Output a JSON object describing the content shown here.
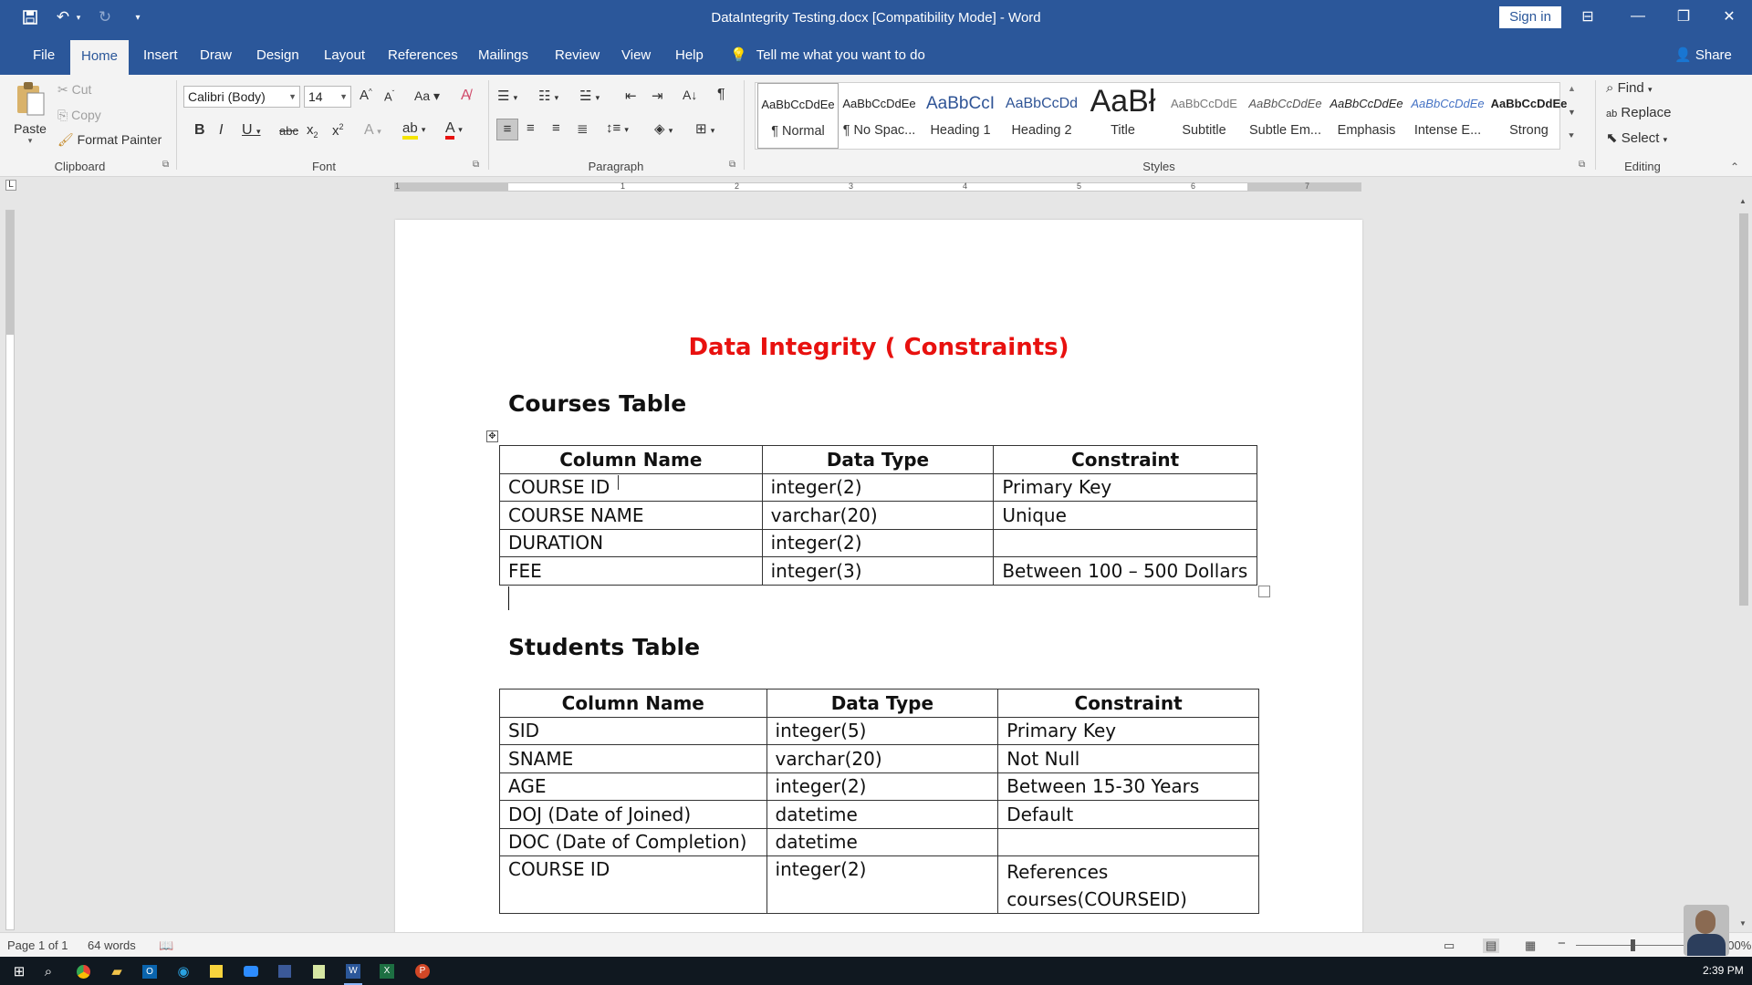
{
  "window": {
    "title": "DataIntegrity Testing.docx [Compatibility Mode]  -  Word",
    "sign_in": "Sign in"
  },
  "ribbon_tabs": [
    "File",
    "Home",
    "Insert",
    "Draw",
    "Design",
    "Layout",
    "References",
    "Mailings",
    "Review",
    "View",
    "Help"
  ],
  "active_tab": "Home",
  "tell_me": "Tell me what you want to do",
  "share": "Share",
  "clipboard": {
    "paste": "Paste",
    "cut": "Cut",
    "copy": "Copy",
    "format_painter": "Format Painter",
    "label": "Clipboard"
  },
  "font": {
    "name": "Calibri (Body)",
    "size": "14",
    "label": "Font"
  },
  "paragraph": {
    "label": "Paragraph"
  },
  "styles": {
    "label": "Styles",
    "items": [
      {
        "preview": "AaBbCcDdEe",
        "name": "¶ Normal"
      },
      {
        "preview": "AaBbCcDdEe",
        "name": "¶ No Spac..."
      },
      {
        "preview": "AaBbCcI",
        "name": "Heading 1"
      },
      {
        "preview": "AaBbCcDd",
        "name": "Heading 2"
      },
      {
        "preview": "AaBł",
        "name": "Title"
      },
      {
        "preview": "AaBbCcDdE",
        "name": "Subtitle"
      },
      {
        "preview": "AaBbCcDdEe",
        "name": "Subtle Em..."
      },
      {
        "preview": "AaBbCcDdEe",
        "name": "Emphasis"
      },
      {
        "preview": "AaBbCcDdEe",
        "name": "Intense E..."
      },
      {
        "preview": "AaBbCcDdEe",
        "name": "Strong"
      }
    ]
  },
  "editing": {
    "find": "Find",
    "replace": "Replace",
    "select": "Select",
    "label": "Editing"
  },
  "ruler_numbers": [
    "1",
    "1",
    "2",
    "3",
    "4",
    "5",
    "6",
    "7"
  ],
  "document": {
    "title": "Data Integrity ( Constraints)",
    "courses_heading": "Courses Table",
    "courses_table": {
      "headers": [
        "Column Name",
        "Data Type",
        "Constraint"
      ],
      "rows": [
        [
          "COURSE ID",
          "integer(2)",
          "Primary Key"
        ],
        [
          "COURSE NAME",
          "varchar(20)",
          "Unique"
        ],
        [
          "DURATION",
          "integer(2)",
          ""
        ],
        [
          "FEE",
          "integer(3)",
          "Between 100 – 500 Dollars"
        ]
      ]
    },
    "students_heading": "Students Table",
    "students_table": {
      "headers": [
        "Column Name",
        "Data Type",
        "Constraint"
      ],
      "rows": [
        [
          "SID",
          "integer(5)",
          "Primary Key"
        ],
        [
          "SNAME",
          "varchar(20)",
          "Not Null"
        ],
        [
          "AGE",
          "integer(2)",
          "Between 15-30 Years"
        ],
        [
          "DOJ (Date of Joined)",
          "datetime",
          "Default"
        ],
        [
          "DOC (Date of Completion)",
          "datetime",
          ""
        ],
        [
          "COURSE ID",
          "integer(2)",
          "References courses(COURSEID)"
        ]
      ]
    }
  },
  "status": {
    "page": "Page 1 of 1",
    "words": "64 words",
    "zoom": "100%"
  },
  "taskbar": {
    "time": "2:39 PM"
  }
}
